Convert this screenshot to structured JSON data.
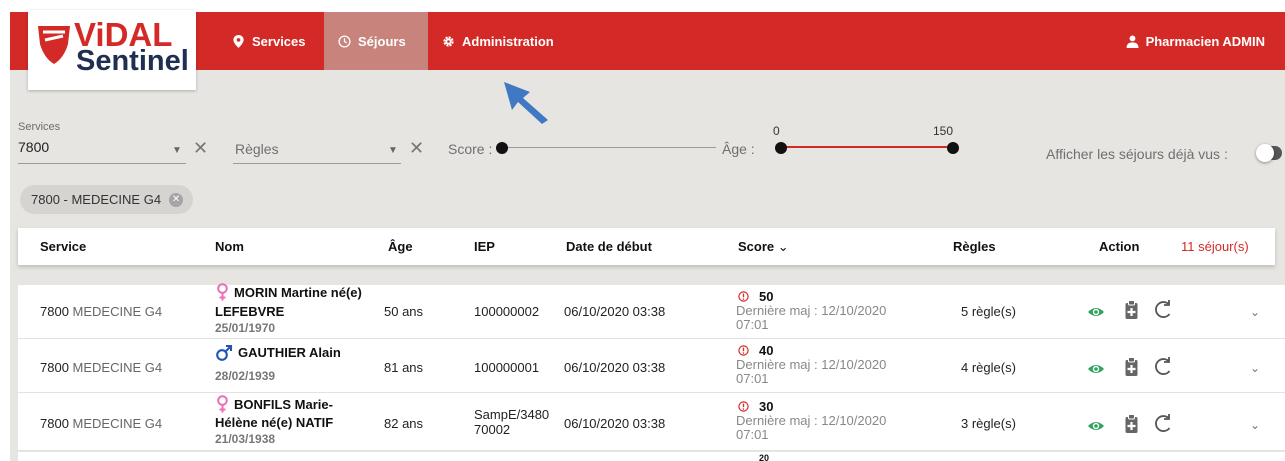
{
  "brand": {
    "name_top": "ViDAL",
    "name_bottom": "Sentinel",
    "color_primary": "#d42a27",
    "color_dark": "#1f2f52"
  },
  "nav": {
    "services": "Services",
    "sejours": "Séjours",
    "administration": "Administration",
    "user": "Pharmacien ADMIN"
  },
  "filters": {
    "services_label": "Services",
    "services_value": "7800",
    "regles_placeholder": "Règles",
    "score_label": "Score :",
    "age_label": "Âge :",
    "age_min": "0",
    "age_max": "150",
    "seen_label": "Afficher les séjours déjà vus :",
    "seen_toggle_on": false
  },
  "chip": {
    "label": "7800 - MEDECINE G4"
  },
  "table": {
    "headers": {
      "service": "Service",
      "nom": "Nom",
      "age": "Âge",
      "iep": "IEP",
      "date": "Date de début",
      "score": "Score",
      "regles": "Règles",
      "action": "Action"
    },
    "count": "11 séjour(s)",
    "rows": [
      {
        "service_code": "7800",
        "service_name": "MEDECINE G4",
        "sex": "female",
        "name_line1": "MORIN Martine né(e)",
        "name_line2": "LEFEBVRE",
        "birthdate": "25/01/1970",
        "age": "50 ans",
        "iep": "100000002",
        "date": "06/10/2020 03:38",
        "score": "50",
        "maj_line1": "Dernière maj : 12/10/2020",
        "maj_line2": "07:01",
        "regles": "5 règle(s)"
      },
      {
        "service_code": "7800",
        "service_name": "MEDECINE G4",
        "sex": "male",
        "name_line1": "GAUTHIER Alain",
        "name_line2": "",
        "birthdate": "28/02/1939",
        "age": "81 ans",
        "iep": "100000001",
        "date": "06/10/2020 03:38",
        "score": "40",
        "maj_line1": "Dernière maj : 12/10/2020",
        "maj_line2": "07:01",
        "regles": "4 règle(s)"
      },
      {
        "service_code": "7800",
        "service_name": "MEDECINE G4",
        "sex": "female",
        "name_line1": "BONFILS Marie-",
        "name_line2": "Hélène né(e) NATIF",
        "birthdate": "21/03/1938",
        "age": "82 ans",
        "iep_line1": "SampE/3480",
        "iep_line2": "70002",
        "date": "06/10/2020 03:38",
        "score": "30",
        "maj_line1": "Dernière maj : 12/10/2020",
        "maj_line2": "07:01",
        "regles": "3 règle(s)"
      }
    ],
    "partial_row_score": "20"
  },
  "colors": {
    "female": "#e86fb1",
    "male": "#1f56b5",
    "eye": "#2ea35b",
    "score_alert": "#d42a27"
  }
}
